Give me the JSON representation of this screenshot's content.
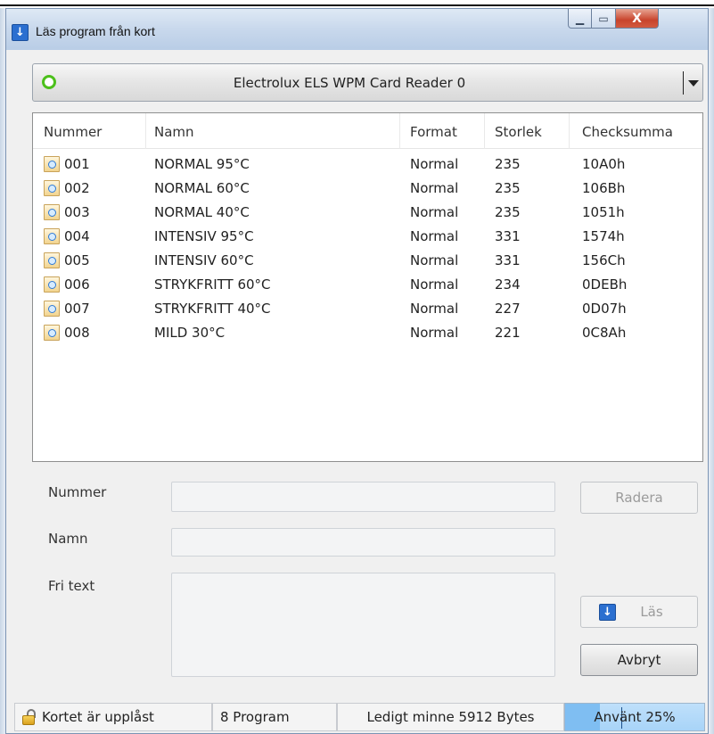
{
  "window": {
    "title": "Läs program från kort",
    "controls": {
      "minimize": "minimize",
      "maximize": "maximize",
      "close": "X"
    }
  },
  "reader": {
    "name": "Electrolux ELS WPM Card Reader 0",
    "status_color": "#4cc01b"
  },
  "list": {
    "columns": [
      "Nummer",
      "Namn",
      "Format",
      "Storlek",
      "Checksumma"
    ],
    "rows": [
      {
        "nummer": "001",
        "namn": "NORMAL 95°C",
        "format": "Normal",
        "storlek": "235",
        "checksumma": "10A0h"
      },
      {
        "nummer": "002",
        "namn": "NORMAL 60°C",
        "format": "Normal",
        "storlek": "235",
        "checksumma": "106Bh"
      },
      {
        "nummer": "003",
        "namn": "NORMAL 40°C",
        "format": "Normal",
        "storlek": "235",
        "checksumma": "1051h"
      },
      {
        "nummer": "004",
        "namn": "INTENSIV 95°C",
        "format": "Normal",
        "storlek": "331",
        "checksumma": "1574h"
      },
      {
        "nummer": "005",
        "namn": "INTENSIV 60°C",
        "format": "Normal",
        "storlek": "331",
        "checksumma": "156Ch"
      },
      {
        "nummer": "006",
        "namn": "STRYKFRITT 60°C",
        "format": "Normal",
        "storlek": "234",
        "checksumma": "0DEBh"
      },
      {
        "nummer": "007",
        "namn": "STRYKFRITT 40°C",
        "format": "Normal",
        "storlek": "227",
        "checksumma": "0D07h"
      },
      {
        "nummer": "008",
        "namn": "MILD 30°C",
        "format": "Normal",
        "storlek": "221",
        "checksumma": "0C8Ah"
      }
    ]
  },
  "form": {
    "nummer_label": "Nummer",
    "namn_label": "Namn",
    "fritext_label": "Fri text",
    "nummer_value": "",
    "namn_value": "",
    "fritext_value": ""
  },
  "buttons": {
    "radera": "Radera",
    "las": "Läs",
    "avbryt": "Avbryt"
  },
  "status": {
    "lock": "Kortet är upplåst",
    "programs": "8 Program",
    "free_memory": "Ledigt minne 5912 Bytes",
    "used": "Använt 25%",
    "used_fraction": 0.25
  }
}
